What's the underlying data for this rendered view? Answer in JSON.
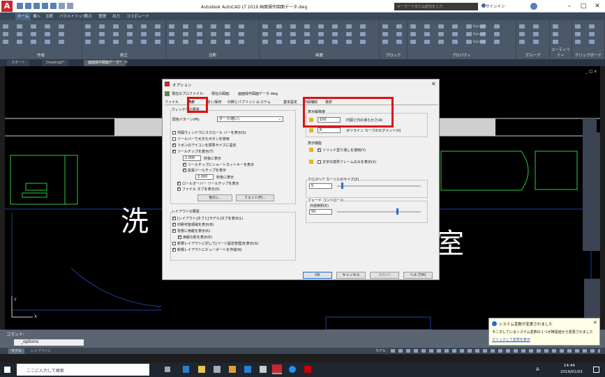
{
  "titlebar": {
    "title": "Autodesk AutoCAD LT 2019   画面操作図面データ.dwg",
    "search_placeholder": "キーワードまたは語句を入力",
    "signin": "サインイン",
    "logo": "A"
  },
  "ribbon_tabs": [
    "ホーム",
    "挿入",
    "注釈",
    "パラメトリック",
    "表示",
    "管理",
    "出力",
    "コラボレート"
  ],
  "ribbon_groups": [
    "作成",
    "修正",
    "注釈",
    "画層",
    "ブロック",
    "プロパティ",
    "グループ",
    "ユーティリティ",
    "クリップボード"
  ],
  "ribbon_texts": {
    "bylayer1": "ByLayer",
    "bylayer2": "ByLayer",
    "bylayer3": "ByLayer"
  },
  "doc_tabs": [
    "スタート",
    "Drawing2*",
    "画面操作図面データ*"
  ],
  "canvas": {
    "chars_left": "洗",
    "chars_right": "室",
    "win_ctrl": "_ □ x"
  },
  "dialog": {
    "title": "オプション",
    "profile_label": "現在のプロファイル:",
    "drawing_label": "現在の図面:",
    "drawing_name": "画面操作図面データ.dwg",
    "tabs": [
      "ファイル",
      "表示",
      "開く/保存",
      "印刷とパブリッシュ",
      "システム",
      "基本設定",
      "作図補助",
      "選択"
    ],
    "window_elements": "ウィンドウの要素",
    "color_scheme_label": "配色パターン(M):",
    "color_scheme_value": "ダーク(暗い)",
    "opts": [
      {
        "label": "作図ウィンドウにスクロール バーを表示(S)",
        "on": false
      },
      {
        "label": "ツールバーで大きなボタンを使用",
        "on": false
      },
      {
        "label": "リボンのアイコンを標準サイズに設定",
        "on": true
      },
      {
        "label": "ツールチップを表示(T)",
        "on": true
      }
    ],
    "tooltip_delay_value": "1.000",
    "tooltip_delay_label": "秒後に表示",
    "shortcut_tips": "ツールチップにショートカットキーを表示",
    "ext_tips": "拡張ツールチップを表示",
    "ext_delay_value": "2.000",
    "ext_delay_label": "秒後に表示",
    "rollover": "ロールオーバー ツールチップを表示",
    "file_tabs": "ファイル タブを表示(S)",
    "color_btn": "色(C)...",
    "font_btn": "フォント(F)...",
    "layout_elements": "レイアウトの要素",
    "layout_opts": [
      "[レイアウト]タブと[モデル]タブを表示(L)",
      "印刷可能領域を表示(B)",
      "背景に用紙を表示(K)",
      "用紙の影を表示(E)",
      "新規レイアウトに対して[ページ設定管理]を表示(G)",
      "新規レイアウトにビューポートを作成(N)"
    ],
    "layout_on": [
      true,
      true,
      true,
      true,
      false,
      true
    ],
    "resolution_title": "表示解像度",
    "res_value1": "100",
    "res_label1": "円弧と円の滑らかさ(A)",
    "res_value2": "8",
    "res_label2": "ポリライン カーブのセグメント(V)",
    "perf_title": "表示機能",
    "perf1": "ソリッド塗り潰しを適用(Y)",
    "perf2": "文字の境界フレームのみを表示(X)",
    "crosshair_title": "クロスヘア カーソルのサイズ(Z)",
    "crosshair_value": "5",
    "fade_title": "フェード コントロール",
    "fade_label": "外部参照(E)",
    "fade_value": "50",
    "ok": "OK",
    "cancel": "キャンセル",
    "apply": "適用(A)",
    "help": "ヘルプ(H)"
  },
  "cmd": {
    "label": "コマンド:",
    "text": "_options"
  },
  "status": {
    "model": "モデル",
    "layout": "レイアウト1",
    "model_right": "モデル"
  },
  "notif": {
    "title": "システム変数が変更されました",
    "line1": "モニタしているシステム変数の１つが推奨値から変更されました",
    "link": "クリックして変更を表示"
  },
  "taskbar": {
    "search": "ここに入力して検索",
    "time": "14:44",
    "date": "2019/01/03",
    "ime": "A"
  },
  "colors": {
    "accent": "#e01010",
    "ribbon": "#4b5869",
    "canvas": "#000000"
  }
}
